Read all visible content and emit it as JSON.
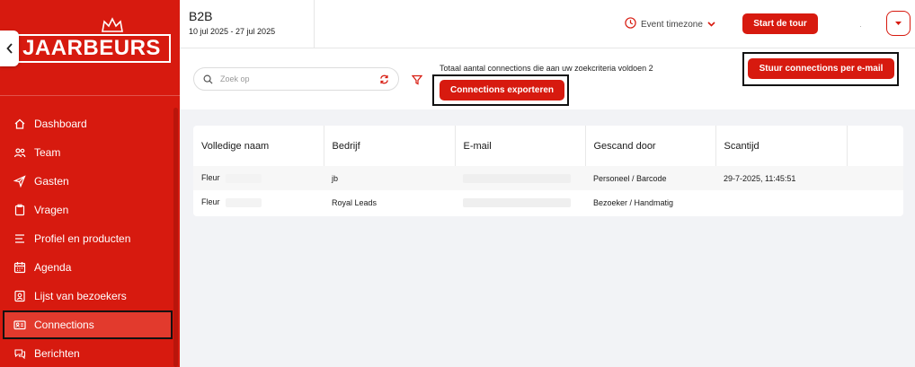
{
  "sidebar": {
    "logo_text": "JAARBEURS",
    "items": [
      {
        "label": "Dashboard",
        "icon": "home-icon"
      },
      {
        "label": "Team",
        "icon": "team-icon"
      },
      {
        "label": "Gasten",
        "icon": "send-icon"
      },
      {
        "label": "Vragen",
        "icon": "clipboard-icon"
      },
      {
        "label": "Profiel en producten",
        "icon": "list-icon"
      },
      {
        "label": "Agenda",
        "icon": "calendar-icon"
      },
      {
        "label": "Lijst van bezoekers",
        "icon": "contact-icon"
      },
      {
        "label": "Connections",
        "icon": "id-card-icon",
        "active": true
      },
      {
        "label": "Berichten",
        "icon": "chat-icon"
      }
    ]
  },
  "header": {
    "event_title": "B2B",
    "event_dates": "10 jul 2025 - 27 jul 2025",
    "timezone_label": "Event timezone",
    "start_tour_label": "Start de tour"
  },
  "filters": {
    "search_placeholder": "Zoek op",
    "total_text": "Totaal aantal connections die aan uw zoekcriteria voldoen 2",
    "export_label": "Connections exporteren",
    "mail_label": "Stuur connections per e-mail"
  },
  "table": {
    "columns": [
      "Volledige naam",
      "Bedrijf",
      "E-mail",
      "Gescand door",
      "Scantijd",
      ""
    ],
    "rows": [
      {
        "name": "Fleur",
        "company": "jb",
        "email": "",
        "scanned_by": "Personeel / Barcode",
        "scan_time": "29-7-2025, 11:45:51"
      },
      {
        "name": "Fleur",
        "company": "Royal Leads",
        "email": "",
        "scanned_by": "Bezoeker / Handmatig",
        "scan_time": ""
      }
    ]
  },
  "colors": {
    "brand_red": "#d71a0f"
  }
}
